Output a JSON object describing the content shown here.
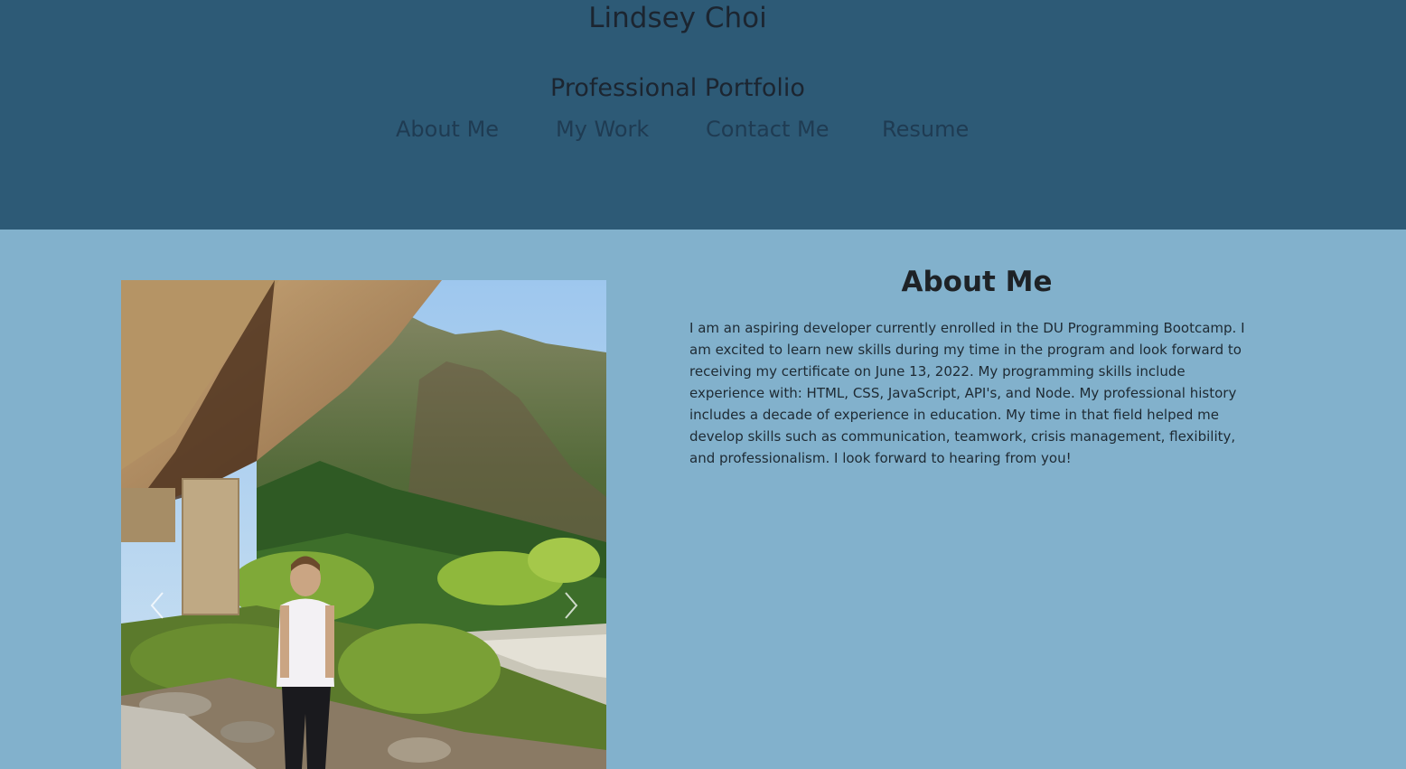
{
  "header": {
    "title": "Lindsey Choi",
    "subtitle": "Professional Portfolio",
    "nav": [
      {
        "label": "About Me"
      },
      {
        "label": "My Work"
      },
      {
        "label": "Contact Me"
      },
      {
        "label": "Resume"
      }
    ]
  },
  "about": {
    "heading": "About Me",
    "body": "I am an aspiring developer currently enrolled in the DU Programming Bootcamp. I am excited to learn new skills during my time in the program and look forward to receiving my certificate on June 13, 2022. My programming skills include experience with: HTML, CSS, JavaScript, API's, and Node. My professional history includes a decade of experience in education. My time in that field helped me develop skills such as communication, teamwork, crisis management, flexibility, and professionalism. I look forward to hearing from you!"
  },
  "carousel": {
    "prev_icon": "chevron-left-icon",
    "next_icon": "chevron-right-icon"
  },
  "colors": {
    "header_bg": "#2d5a76",
    "main_bg": "#82b1cc"
  }
}
